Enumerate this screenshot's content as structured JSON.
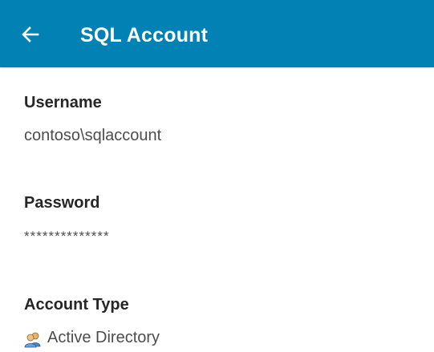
{
  "app_bar": {
    "title": "SQL Account",
    "back_icon": "arrow-left-icon",
    "color": "#0281b5"
  },
  "fields": {
    "username": {
      "label": "Username",
      "value": "contoso\\sqlaccount"
    },
    "password": {
      "label": "Password",
      "value": "**************"
    },
    "account_type": {
      "label": "Account Type",
      "icon": "active-directory-user-icon",
      "value": "Active Directory"
    }
  }
}
